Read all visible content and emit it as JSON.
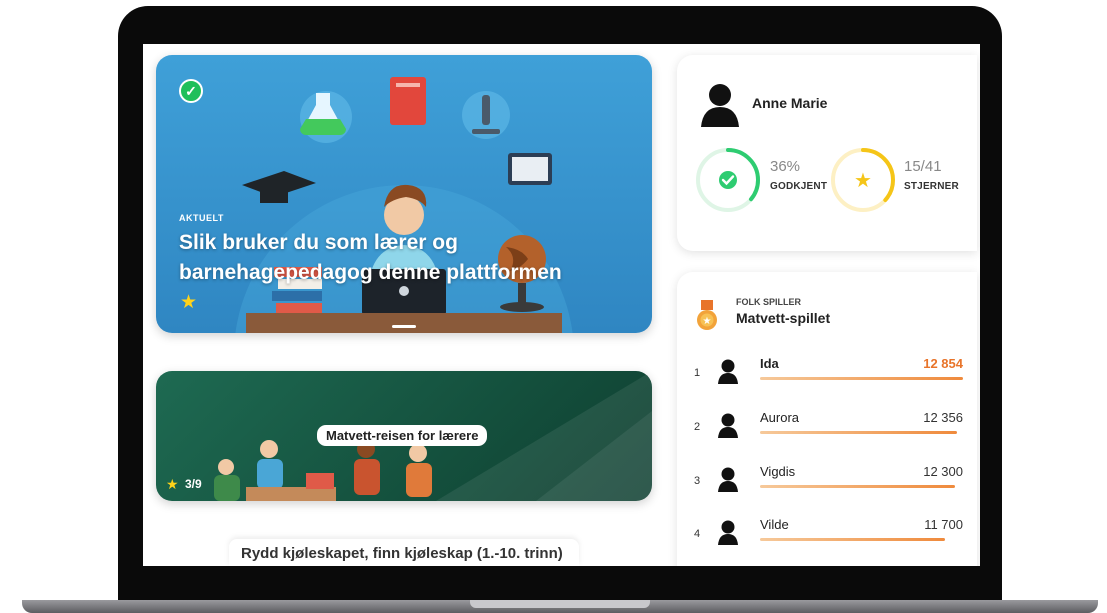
{
  "hero": {
    "kicker": "AKTUELT",
    "title": "Slik bruker du som lærer og barnehagepedagog denne plattformen",
    "completed_icon": "check-circle-icon",
    "star_icon": "star-icon"
  },
  "course": {
    "title": "Matvett-reisen for lærere",
    "progress": "3/9",
    "star_icon": "star-icon"
  },
  "next_card": {
    "title": "Rydd kjøleskapet, finn kjøleskap (1.-10. trinn)"
  },
  "profile": {
    "name": "Anne Marie",
    "approved_pct": "36%",
    "approved_label": "GODKJENT",
    "approved_fraction": 0.36,
    "stars_value": "15/41",
    "stars_label": "STJERNER",
    "stars_fraction": 0.366,
    "colors": {
      "approved": "#2ecc71",
      "stars": "#f5c518"
    }
  },
  "leaderboard": {
    "kicker": "FOLK SPILLER",
    "game": "Matvett-spillet",
    "rows": [
      {
        "rank": "1",
        "name": "Ida",
        "score": "12 854",
        "fraction": 1.0,
        "highlight": true
      },
      {
        "rank": "2",
        "name": "Aurora",
        "score": "12 356",
        "fraction": 0.97,
        "highlight": false
      },
      {
        "rank": "3",
        "name": "Vigdis",
        "score": "12 300",
        "fraction": 0.96,
        "highlight": false
      },
      {
        "rank": "4",
        "name": "Vilde",
        "score": "11 700",
        "fraction": 0.91,
        "highlight": false
      }
    ],
    "colors": {
      "leader": "#e8742a",
      "bar": "#ef8a3c"
    }
  }
}
